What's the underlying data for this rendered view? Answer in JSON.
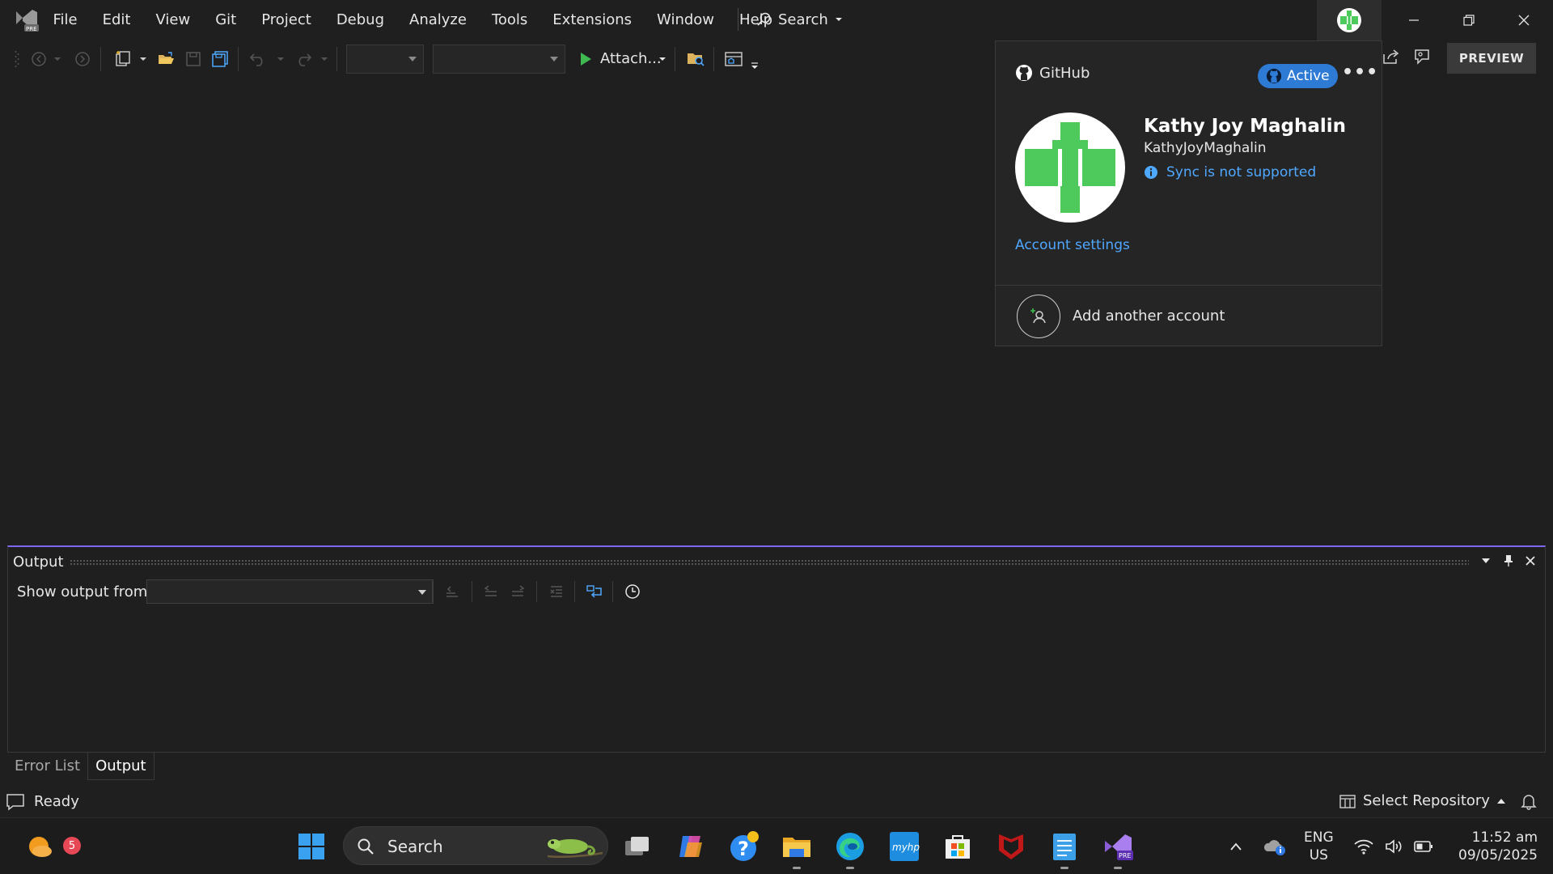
{
  "menu": {
    "items": [
      "File",
      "Edit",
      "View",
      "Git",
      "Project",
      "Debug",
      "Analyze",
      "Tools",
      "Extensions",
      "Window",
      "Help"
    ],
    "search_label": "Search"
  },
  "toolbar": {
    "attach_label": "Attach...",
    "preview_label": "PREVIEW"
  },
  "account_popup": {
    "provider": "GitHub",
    "status": "Active",
    "more": "•••",
    "name": "Kathy Joy Maghalin",
    "handle": "KathyJoyMaghalin",
    "sync_message": "Sync is not supported",
    "settings_link": "Account settings",
    "add_account": "Add another account",
    "avatar_color": "#4ec95c"
  },
  "output_panel": {
    "title": "Output",
    "show_output_label": "Show output from:",
    "source_value": "",
    "accent_color": "#7b68ee"
  },
  "bottom_tabs": [
    {
      "label": "Error List",
      "active": false
    },
    {
      "label": "Output",
      "active": true
    }
  ],
  "status": {
    "ready": "Ready",
    "select_repository": "Select Repository"
  },
  "taskbar": {
    "weather_badge": "5",
    "search_label": "Search",
    "lang_line1": "ENG",
    "lang_line2": "US",
    "time": "11:52 am",
    "date": "09/05/2025"
  }
}
